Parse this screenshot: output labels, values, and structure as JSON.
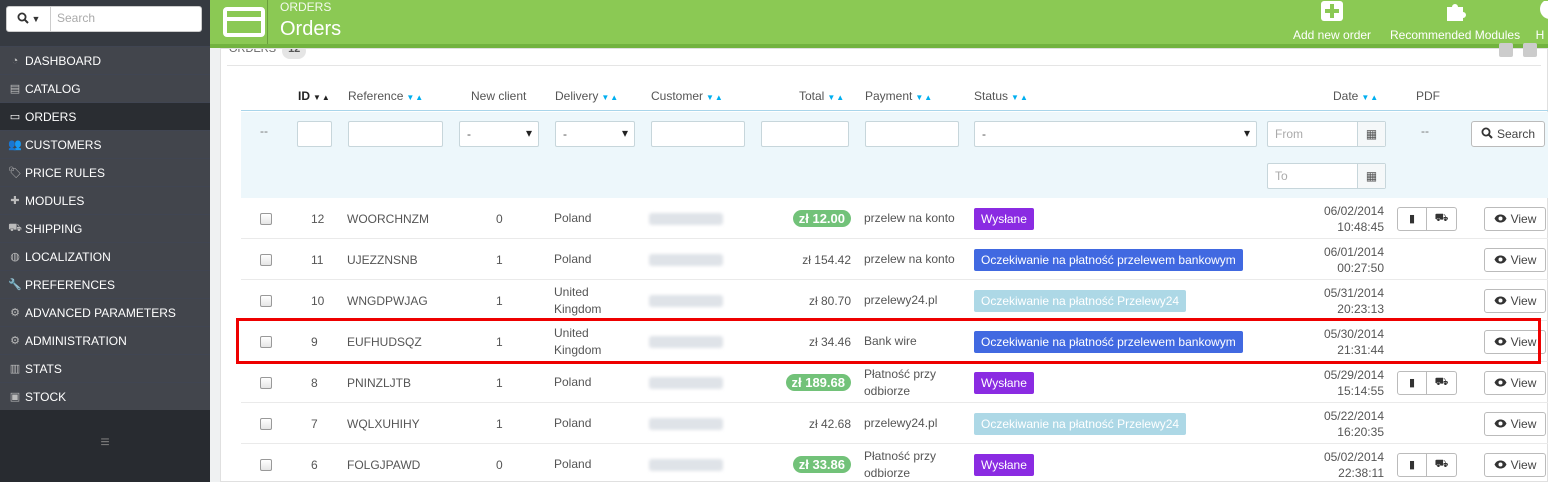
{
  "sidebar": {
    "search_placeholder": "Search",
    "items": [
      {
        "label": "DASHBOARD",
        "icon": "dashboard-icon",
        "glyph": "◔"
      },
      {
        "label": "CATALOG",
        "icon": "book-icon",
        "glyph": "▤"
      },
      {
        "label": "ORDERS",
        "icon": "credit-card-icon",
        "glyph": "▭"
      },
      {
        "label": "CUSTOMERS",
        "icon": "users-icon",
        "glyph": "👥"
      },
      {
        "label": "PRICE RULES",
        "icon": "tags-icon",
        "glyph": "🏷"
      },
      {
        "label": "MODULES",
        "icon": "puzzle-icon",
        "glyph": "✚"
      },
      {
        "label": "SHIPPING",
        "icon": "truck-icon",
        "glyph": "⛟"
      },
      {
        "label": "LOCALIZATION",
        "icon": "globe-icon",
        "glyph": "◍"
      },
      {
        "label": "PREFERENCES",
        "icon": "wrench-icon",
        "glyph": "🔧"
      },
      {
        "label": "ADVANCED PARAMETERS",
        "icon": "cogs-icon",
        "glyph": "⚙"
      },
      {
        "label": "ADMINISTRATION",
        "icon": "cog-icon",
        "glyph": "⚙"
      },
      {
        "label": "STATS",
        "icon": "bar-chart-icon",
        "glyph": "▥"
      },
      {
        "label": "STOCK",
        "icon": "archive-icon",
        "glyph": "▣"
      }
    ]
  },
  "header": {
    "breadcrumb": "ORDERS",
    "title": "Orders",
    "add_new": "Add new order",
    "recommended": "Recommended Modules",
    "help": "H"
  },
  "panel": {
    "heading": "ORDERS",
    "count": "12"
  },
  "table": {
    "headers": {
      "id": "ID",
      "reference": "Reference",
      "new_client": "New client",
      "delivery": "Delivery",
      "customer": "Customer",
      "total": "Total",
      "payment": "Payment",
      "status": "Status",
      "date": "Date",
      "pdf": "PDF"
    },
    "filters": {
      "dash": "--",
      "new_client": "-",
      "delivery": "-",
      "status": "-",
      "date_from": "From",
      "date_to": "To",
      "pdf_dash": "--",
      "search": "Search"
    },
    "rows": [
      {
        "id": "12",
        "reference": "WOORCHNZM",
        "new_client": "0",
        "delivery": [
          "Poland"
        ],
        "customer": "A. Rutkowski",
        "total": "zł 12.00",
        "total_badge": true,
        "payment": [
          "przelew na konto"
        ],
        "status": "Wysłane",
        "status_color": "#8a2be2",
        "date": "06/02/2014",
        "time": "10:48:45",
        "pdf": true,
        "view": "View"
      },
      {
        "id": "11",
        "reference": "UJEZZNSNB",
        "new_client": "1",
        "delivery": [
          "Poland"
        ],
        "customer": "A. Czarnolski",
        "total": "zł 154.42",
        "total_badge": false,
        "payment": [
          "przelew na konto"
        ],
        "status": "Oczekiwanie na płatność przelewem bankowym",
        "status_color": "#4169e1",
        "date": "06/01/2014",
        "time": "00:27:50",
        "pdf": false,
        "view": "View"
      },
      {
        "id": "10",
        "reference": "WNGDPWJAG",
        "new_client": "1",
        "delivery": [
          "United",
          "Kingdom"
        ],
        "customer": "P. Janowski",
        "total": "zł 80.70",
        "total_badge": false,
        "payment": [
          "przelewy24.pl"
        ],
        "status": "Oczekiwanie na płatność Przelewy24",
        "status_color": "#add8e6",
        "date": "05/31/2014",
        "time": "20:23:13",
        "pdf": false,
        "view": "View"
      },
      {
        "id": "9",
        "reference": "EUFHUDSQZ",
        "new_client": "1",
        "delivery": [
          "United",
          "Kingdom"
        ],
        "customer": "A. Sander",
        "total": "zł 34.46",
        "total_badge": false,
        "payment": [
          "Bank wire"
        ],
        "status": "Oczekiwanie na płatność przelewem bankowym",
        "status_color": "#4169e1",
        "date": "05/30/2014",
        "time": "21:31:44",
        "pdf": false,
        "view": "View"
      },
      {
        "id": "8",
        "reference": "PNINZLJTB",
        "new_client": "1",
        "delivery": [
          "Poland"
        ],
        "customer": "J. Nasprzak",
        "total": "zł 189.68",
        "total_badge": true,
        "payment": [
          "Płatność przy",
          "odbiorze"
        ],
        "status": "Wysłane",
        "status_color": "#8a2be2",
        "date": "05/29/2014",
        "time": "15:14:55",
        "pdf": true,
        "view": "View"
      },
      {
        "id": "7",
        "reference": "WQLXUHIHY",
        "new_client": "1",
        "delivery": [
          "Poland"
        ],
        "customer": "K. Zimpwski",
        "total": "zł 42.68",
        "total_badge": false,
        "payment": [
          "przelewy24.pl"
        ],
        "status": "Oczekiwanie na płatność Przelewy24",
        "status_color": "#add8e6",
        "date": "05/22/2014",
        "time": "16:20:35",
        "pdf": false,
        "view": "View"
      },
      {
        "id": "6",
        "reference": "FOLGJPAWD",
        "new_client": "0",
        "delivery": [
          "Poland"
        ],
        "customer": "A. Rutkowski",
        "total": "zł 33.86",
        "total_badge": true,
        "payment": [
          "Płatność przy",
          "odbiorze"
        ],
        "status": "Wysłane",
        "status_color": "#8a2be2",
        "date": "05/02/2014",
        "time": "22:38:11",
        "pdf": true,
        "view": "View"
      }
    ]
  },
  "colors": {
    "header_green": "#8bc954",
    "sidebar_dark": "#363a41",
    "highlight": "#e00000",
    "total_badge": "#72c279"
  }
}
